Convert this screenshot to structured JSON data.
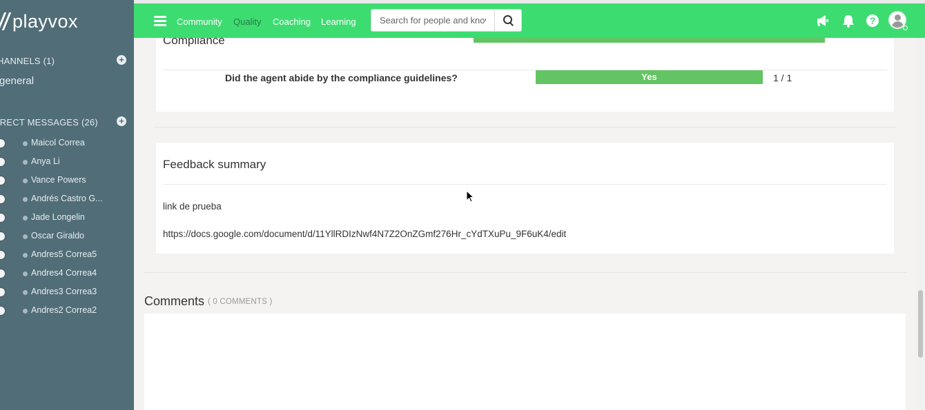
{
  "brand": {
    "logo_text": "playvox"
  },
  "sidebar": {
    "channels_header": "HANNELS (1)",
    "channels": [
      "general"
    ],
    "dm_header": "IRECT MESSAGES (26)",
    "direct_messages": [
      "Maicol Correa",
      "Anya Li",
      "Vance Powers",
      "Andrés Castro G...",
      "Jade Longelin",
      "Oscar Giraldo",
      "Andres5 Correa5",
      "Andres4 Correa4",
      "Andres3 Correa3",
      "Andres2 Correa2"
    ]
  },
  "topnav": {
    "links": [
      "Community",
      "Quality",
      "Coaching",
      "Learning"
    ],
    "active_link": "Quality",
    "search_placeholder": "Search for people and knowledge",
    "accent_color": "#3ddc71"
  },
  "compliance": {
    "title": "Compliance",
    "question": "Did the agent abide by the compliance guidelines?",
    "answer": "Yes",
    "score": "1 / 1",
    "answer_color": "#62c462"
  },
  "feedback": {
    "title": "Feedback summary",
    "line1": "link de prueba",
    "line2": "https://docs.google.com/document/d/11YllRDIzNwf4N7Z2OnZGmf276Hr_cYdTXuPu_9F6uK4/edit"
  },
  "comments": {
    "title": "Comments",
    "count": "( 0 COMMENTS )"
  }
}
